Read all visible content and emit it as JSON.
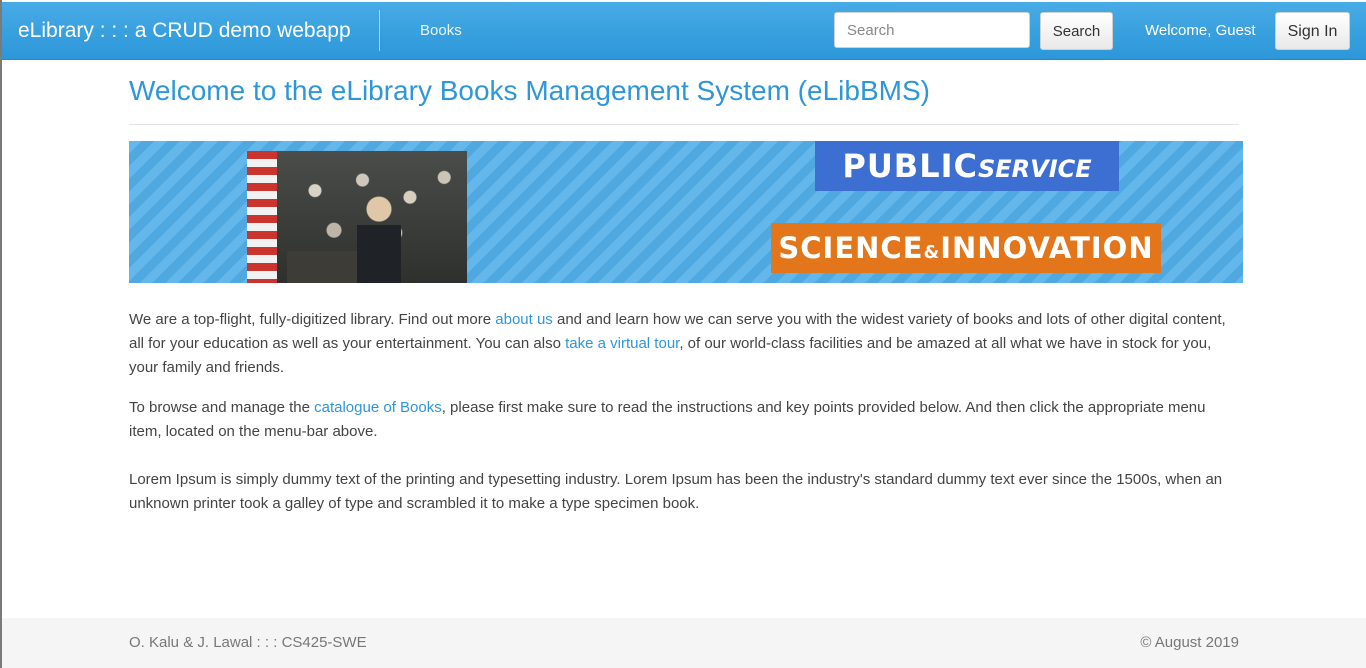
{
  "navbar": {
    "brand": "eLibrary : : : a CRUD demo webapp",
    "menu_books": "Books",
    "search_placeholder": "Search",
    "search_button": "Search",
    "welcome_text": "Welcome, Guest",
    "signin_button": "Sign In"
  },
  "main": {
    "title": "Welcome to the eLibrary Books Management System (eLibBMS)",
    "banner": {
      "label_top_big": "PUBLIC",
      "label_top_small": "SERVICE",
      "label_bottom_left": "SCIENCE",
      "label_bottom_amp": "&",
      "label_bottom_right": "INNOVATION"
    },
    "paragraph1": {
      "t1": "We are a top-flight, fully-digitized library. Find out more ",
      "link1": "about us",
      "t2": " and and learn how we can serve you with the widest variety of books and lots of other digital content, all for your education as well as your entertainment. You can also ",
      "link2": "take a virtual tour",
      "t3": ", of our world-class facilities and be amazed at all what we have in stock for you, your family and friends."
    },
    "paragraph2": {
      "t1": "To browse and manage the ",
      "link1": "catalogue of Books",
      "t2": ", please first make sure to read the instructions and key points provided below. And then click the appropriate menu item, located on the menu-bar above."
    },
    "paragraph3": "Lorem Ipsum is simply dummy text of the printing and typesetting industry. Lorem Ipsum has been the industry's standard dummy text ever since the 1500s, when an unknown printer took a galley of type and scrambled it to make a type specimen book."
  },
  "footer": {
    "left": "O. Kalu & J. Lawal : : : CS425-SWE",
    "right": "© August 2019"
  },
  "colors": {
    "navbar": "#2c97d9",
    "accent": "#2f97d9",
    "footer_bg": "#f5f5f5"
  }
}
